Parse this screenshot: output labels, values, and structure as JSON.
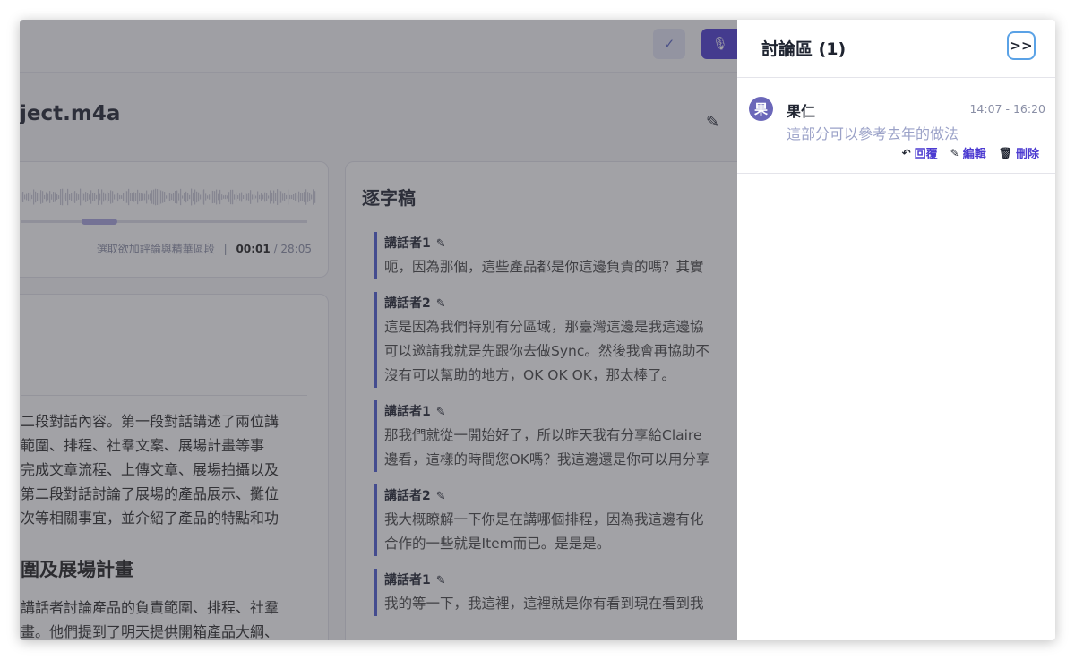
{
  "topbar": {
    "check_icon": "check-icon",
    "mic_icon": "microphone-icon"
  },
  "file": {
    "title": "ject.m4a"
  },
  "audio": {
    "meta_label": "選取欲加評論與精華區段",
    "separator": "|",
    "current_time": "00:01",
    "total_time": "/ 28:05",
    "progress_fraction": 0.0006
  },
  "summary": {
    "paragraph1": "二段對話內容。第一段對話講述了兩位講\n範圍、排程、社羣文案、展場計畫等事\n完成文章流程、上傳文章、展場拍攝以及\n第二段對話討論了展場的產品展示、攤位\n次等相關事宜，並介紹了產品的特點和功",
    "heading": "圍及展場計畫",
    "paragraph2": "講話者討論產品的負責範圍、排程、社羣\n畫。他們提到了明天提供開箱產品大綱、"
  },
  "transcript": {
    "title": "逐字稿",
    "segments": [
      {
        "speaker": "講話者1",
        "text": "呃，因為那個，這些產品都是你這邊負責的嗎？其實"
      },
      {
        "speaker": "講話者2",
        "text": "這是因為我們特別有分區域，那臺灣這邊是我這邊協\n可以邀請我就是先跟你去做Sync。然後我會再協助不\n沒有可以幫助的地方，OK OK OK，那太棒了。"
      },
      {
        "speaker": "講話者1",
        "text": "那我們就從一開始好了，所以昨天我有分享給Claire\n邊看，這樣的時間您OK嗎？我這邊還是你可以用分享"
      },
      {
        "speaker": "講話者2",
        "text": "我大概瞭解一下你是在講哪個排程，因為我這邊有化\n合作的一些就是Item而已。是是是。"
      },
      {
        "speaker": "講話者1",
        "text": "我的等一下，我這裡，這裡就是你有看到現在看到我"
      }
    ]
  },
  "discussion": {
    "title": "討論區 (1)",
    "collapse_label": ">>",
    "comments": [
      {
        "avatar": "果",
        "author": "果仁",
        "time": "14:07 - 16:20",
        "text": "這部分可以參考去年的做法",
        "reply": "回覆",
        "edit": "編輯",
        "delete": "刪除"
      }
    ]
  },
  "colors": {
    "accent": "#4c3bd1",
    "overlay": "#3c3c46",
    "speaker_bar": "#4c5bd4"
  }
}
